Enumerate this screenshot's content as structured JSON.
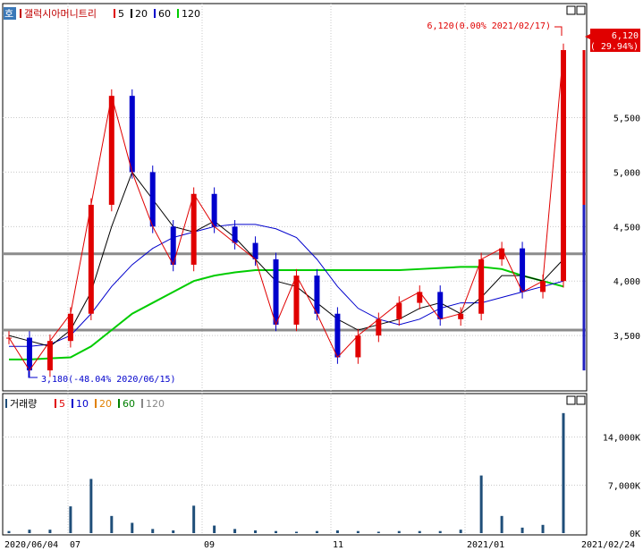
{
  "price_panel": {
    "tab_label": "호",
    "legend": [
      {
        "label": "갤럭시아머니트리",
        "color": "#c00000"
      },
      {
        "label": "5",
        "color": "#e00000"
      },
      {
        "label": "20",
        "color": "#000000"
      },
      {
        "label": "60",
        "color": "#0000cc"
      },
      {
        "label": "120",
        "color": "#00cc00"
      }
    ],
    "last_price_label": "6,120",
    "last_change_label": "( 29.94%)",
    "high_annotation": "6,120(0.00% 2021/02/17)",
    "low_annotation": "3,180(-48.04% 2020/06/15)"
  },
  "volume_panel": {
    "legend": [
      {
        "label": "거래량",
        "color": "#1f4e79"
      },
      {
        "label": "5",
        "color": "#e00000"
      },
      {
        "label": "10",
        "color": "#0000cc"
      },
      {
        "label": "20",
        "color": "#e08000"
      },
      {
        "label": "60",
        "color": "#008000"
      },
      {
        "label": "120",
        "color": "#888888"
      }
    ]
  },
  "x_axis_labels": [
    "2020/06/04",
    "07",
    "09",
    "11",
    "2021/01",
    "2021/02/24"
  ],
  "chart_data": [
    {
      "type": "candlestick",
      "title": "갤럭시아머니트리",
      "moving_averages": [
        "5",
        "20",
        "60",
        "120"
      ],
      "yticks": [
        3500,
        4000,
        4500,
        5000,
        5500
      ],
      "ytick_labels": [
        "3,500",
        "4,000",
        "4,500",
        "5,000",
        "5,500"
      ],
      "ylim": [
        3000,
        6350
      ],
      "horizontal_lines": [
        4250,
        3550
      ],
      "x": [
        "2020/06/04",
        "2020/06/15",
        "2020/07/01",
        "2020/07/15",
        "2020/07/27",
        "2020/08/03",
        "2020/08/14",
        "2020/08/21",
        "2020/08/28",
        "2020/09/03",
        "2020/09/11",
        "2020/09/21",
        "2020/09/29",
        "2020/10/08",
        "2020/10/16",
        "2020/10/26",
        "2020/11/02",
        "2020/11/10",
        "2020/11/20",
        "2020/12/01",
        "2020/12/10",
        "2020/12/21",
        "2021/01/04",
        "2021/01/12",
        "2021/01/20",
        "2021/01/28",
        "2021/02/05",
        "2021/02/17"
      ],
      "close": [
        3480,
        3180,
        3450,
        3700,
        4700,
        5700,
        5000,
        4500,
        4150,
        4800,
        4500,
        4350,
        4200,
        3600,
        4050,
        3700,
        3300,
        3500,
        3650,
        3800,
        3900,
        3650,
        3700,
        4200,
        4300,
        3900,
        4000,
        6120
      ],
      "ma20": [
        3500,
        3450,
        3400,
        3550,
        3900,
        4500,
        5000,
        4750,
        4500,
        4450,
        4550,
        4400,
        4200,
        4000,
        3950,
        3800,
        3650,
        3550,
        3600,
        3650,
        3750,
        3800,
        3700,
        3850,
        4050,
        4050,
        4000,
        4200
      ],
      "ma60": [
        3400,
        3400,
        3420,
        3500,
        3700,
        3950,
        4150,
        4300,
        4400,
        4450,
        4500,
        4520,
        4520,
        4480,
        4400,
        4200,
        3950,
        3750,
        3650,
        3600,
        3650,
        3750,
        3800,
        3800,
        3850,
        3900,
        3950,
        4000
      ],
      "ma120": [
        3280,
        3280,
        3290,
        3300,
        3400,
        3550,
        3700,
        3800,
        3900,
        4000,
        4050,
        4080,
        4100,
        4100,
        4100,
        4100,
        4100,
        4100,
        4100,
        4100,
        4110,
        4120,
        4130,
        4130,
        4110,
        4050,
        4000,
        3950
      ]
    },
    {
      "type": "bar",
      "title": "거래량",
      "ylabel": "",
      "yticks": [
        0,
        7000,
        14000
      ],
      "ytick_labels": [
        "0K",
        "7,000K",
        "14,000K"
      ],
      "ylim": [
        0,
        18000
      ],
      "categories": [
        "2020/06/04",
        "2020/06/15",
        "2020/07/01",
        "2020/07/15",
        "2020/07/27",
        "2020/08/03",
        "2020/08/14",
        "2020/08/21",
        "2020/08/28",
        "2020/09/03",
        "2020/09/11",
        "2020/09/21",
        "2020/09/29",
        "2020/10/08",
        "2020/10/16",
        "2020/10/26",
        "2020/11/02",
        "2020/11/10",
        "2020/11/20",
        "2020/12/01",
        "2020/12/10",
        "2020/12/21",
        "2021/01/04",
        "2021/01/12",
        "2021/01/20",
        "2021/01/28",
        "2021/02/05",
        "2021/02/17"
      ],
      "values": [
        300,
        500,
        500,
        3900,
        7900,
        2500,
        1500,
        600,
        400,
        4000,
        1100,
        600,
        400,
        300,
        200,
        300,
        400,
        300,
        200,
        300,
        300,
        300,
        500,
        8400,
        2500,
        800,
        1200,
        17500
      ]
    }
  ]
}
